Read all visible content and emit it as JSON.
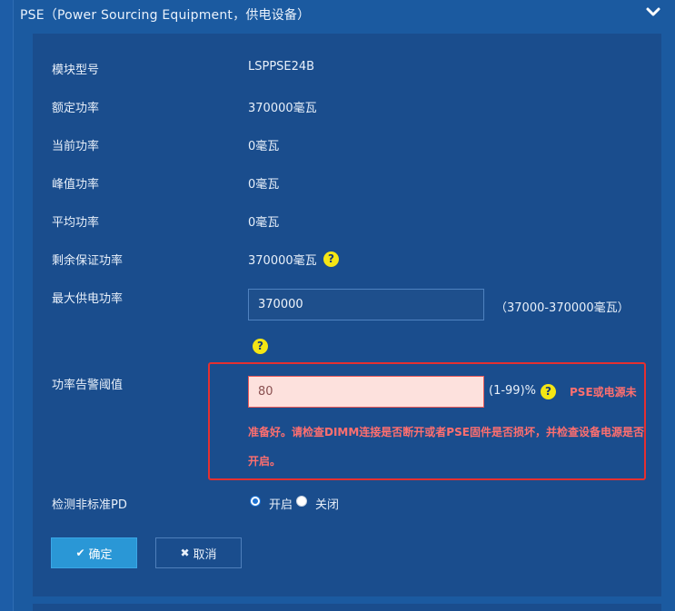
{
  "panel": {
    "title": "PSE（Power Sourcing Equipment，供电设备）"
  },
  "fields": {
    "model": {
      "label": "模块型号",
      "value": "LSPPSE24B"
    },
    "rated_power": {
      "label": "额定功率",
      "value": "370000毫瓦"
    },
    "current_power": {
      "label": "当前功率",
      "value": "0毫瓦"
    },
    "peak_power": {
      "label": "峰值功率",
      "value": "0毫瓦"
    },
    "avg_power": {
      "label": "平均功率",
      "value": "0毫瓦"
    },
    "remaining_power": {
      "label": "剩余保证功率",
      "value": "370000毫瓦"
    },
    "max_power": {
      "label": "最大供电功率",
      "value": "370000",
      "range": "（37000-370000毫瓦）"
    },
    "alarm_threshold": {
      "label": "功率告警阈值",
      "value": "80",
      "range": "(1-99)%",
      "error_line1": "PSE或电源未",
      "error_line2": "准备好。请检查DIMM连接是否断开或者PSE固件是否损坏，并检查设备电源是否",
      "error_line3": "开启。"
    },
    "nonstandard_pd": {
      "label": "检测非标准PD",
      "options": [
        "开启",
        "关闭"
      ],
      "selected": "开启"
    }
  },
  "buttons": {
    "ok": "确定",
    "cancel": "取消"
  },
  "icons": {
    "help": "?",
    "ok_icon": "✔",
    "cancel_icon": "✖"
  },
  "colors": {
    "background": "#1d5da7",
    "panel": "#1a4d8d",
    "error": "#e53030",
    "primary_button": "#2a97d6",
    "help_icon": "#f5e614"
  }
}
